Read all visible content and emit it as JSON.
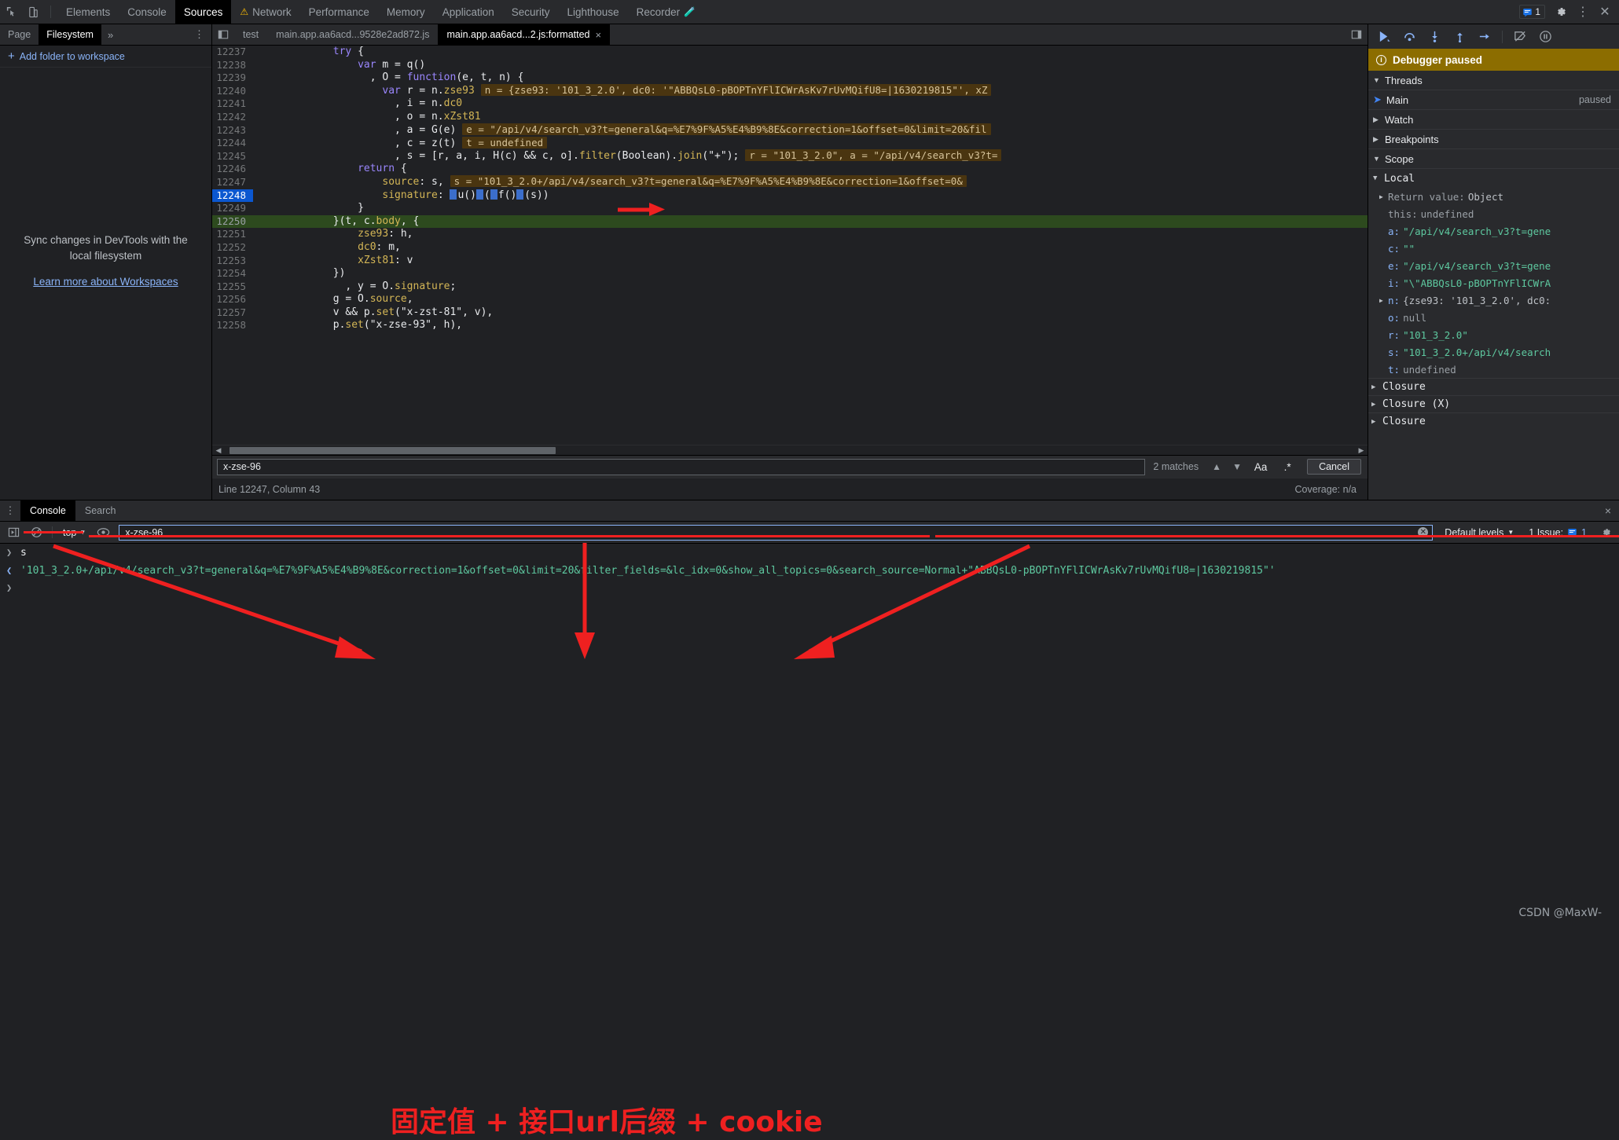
{
  "topbar": {
    "icons": [
      "inspect-element-icon",
      "device-toolbar-icon"
    ],
    "tabs": [
      {
        "label": "Elements",
        "active": false,
        "warn": false
      },
      {
        "label": "Console",
        "active": false,
        "warn": false
      },
      {
        "label": "Sources",
        "active": true,
        "warn": false
      },
      {
        "label": "Network",
        "active": false,
        "warn": true
      },
      {
        "label": "Performance",
        "active": false,
        "warn": false
      },
      {
        "label": "Memory",
        "active": false,
        "warn": false
      },
      {
        "label": "Application",
        "active": false,
        "warn": false
      },
      {
        "label": "Security",
        "active": false,
        "warn": false
      },
      {
        "label": "Lighthouse",
        "active": false,
        "warn": false
      },
      {
        "label": "Recorder",
        "active": false,
        "warn": false,
        "flask": true
      }
    ],
    "message_count": "1",
    "settings_label": "gear-icon",
    "more_label": "more-options-icon",
    "close_label": "close-devtools-icon"
  },
  "navigator": {
    "tabs": [
      {
        "label": "Page",
        "active": false
      },
      {
        "label": "Filesystem",
        "active": true
      }
    ],
    "more": "»",
    "menu": "⋮",
    "add_folder_label": "Add folder to workspace",
    "empty_text": "Sync changes in DevTools with the local filesystem",
    "empty_link": "Learn more about Workspaces"
  },
  "editor": {
    "tabs": [
      {
        "label": "test",
        "active": false,
        "closable": false
      },
      {
        "label": "main.app.aa6acd...9528e2ad872.js",
        "active": false,
        "closable": false
      },
      {
        "label": "main.app.aa6acd...2.js:formatted",
        "active": true,
        "closable": true
      }
    ],
    "close_glyph": "×",
    "lines": [
      {
        "n": "12237",
        "indent": 13,
        "state": "normal",
        "tokens": [
          {
            "t": "try ",
            "c": "k"
          },
          {
            "t": "{",
            "c": "p"
          }
        ]
      },
      {
        "n": "12238",
        "indent": 17,
        "state": "normal",
        "tokens": [
          {
            "t": "var ",
            "c": "k"
          },
          {
            "t": "m = q()",
            "c": "p"
          }
        ]
      },
      {
        "n": "12239",
        "indent": 19,
        "state": "normal",
        "tokens": [
          {
            "t": ", O = ",
            "c": "p"
          },
          {
            "t": "function",
            "c": "k"
          },
          {
            "t": "(e, t, n) {",
            "c": "p"
          }
        ]
      },
      {
        "n": "12240",
        "indent": 21,
        "state": "normal",
        "tokens": [
          {
            "t": "var ",
            "c": "k"
          },
          {
            "t": "r = n.",
            "c": "p"
          },
          {
            "t": "zse93",
            "c": "pr"
          }
        ],
        "hint": "n = {zse93: '101_3_2.0', dc0: '\"ABBQsL0-pBOPTnYFlICWrAsKv7rUvMQifU8=|1630219815\"', xZ"
      },
      {
        "n": "12241",
        "indent": 23,
        "state": "normal",
        "tokens": [
          {
            "t": ", i = n.",
            "c": "p"
          },
          {
            "t": "dc0",
            "c": "pr"
          }
        ]
      },
      {
        "n": "12242",
        "indent": 23,
        "state": "normal",
        "tokens": [
          {
            "t": ", o = n.",
            "c": "p"
          },
          {
            "t": "xZst81",
            "c": "pr"
          }
        ]
      },
      {
        "n": "12243",
        "indent": 23,
        "state": "normal",
        "tokens": [
          {
            "t": ", a = G(e)",
            "c": "p"
          }
        ],
        "hint": "e = \"/api/v4/search_v3?t=general&q=%E7%9F%A5%E4%B9%8E&correction=1&offset=0&limit=20&fil"
      },
      {
        "n": "12244",
        "indent": 23,
        "state": "normal",
        "tokens": [
          {
            "t": ", c = z(t)",
            "c": "p"
          }
        ],
        "hint": "t = undefined"
      },
      {
        "n": "12245",
        "indent": 23,
        "state": "normal",
        "tokens": [
          {
            "t": ", s = [r, a, i, H(c) && c, o].",
            "c": "p"
          },
          {
            "t": "filter",
            "c": "fn"
          },
          {
            "t": "(Boolean).",
            "c": "p"
          },
          {
            "t": "join",
            "c": "fn"
          },
          {
            "t": "(\"+\");",
            "c": "p"
          }
        ],
        "hint": "r = \"101_3_2.0\", a = \"/api/v4/search_v3?t="
      },
      {
        "n": "12246",
        "indent": 17,
        "state": "normal",
        "tokens": [
          {
            "t": "return ",
            "c": "k"
          },
          {
            "t": "{",
            "c": "p"
          }
        ]
      },
      {
        "n": "12247",
        "indent": 21,
        "state": "normal",
        "tokens": [
          {
            "t": "source",
            "c": "pr"
          },
          {
            "t": ": s,",
            "c": "p"
          }
        ],
        "hint": "s = \"101_3_2.0+/api/v4/search_v3?t=general&q=%E7%9F%A5%E4%B9%8E&correction=1&offset=0&"
      },
      {
        "n": "12248",
        "indent": 21,
        "state": "selected",
        "tokens": [
          {
            "t": "signature",
            "c": "pr"
          },
          {
            "t": ": ",
            "c": "p"
          },
          {
            "t": "▶",
            "c": "chip"
          },
          {
            "t": "u()",
            "c": "p"
          },
          {
            "t": "▶",
            "c": "chip"
          },
          {
            "t": "(",
            "c": "p"
          },
          {
            "t": "▶",
            "c": "chip"
          },
          {
            "t": "f()",
            "c": "p"
          },
          {
            "t": "▶",
            "c": "chip"
          },
          {
            "t": "(s))",
            "c": "p"
          }
        ]
      },
      {
        "n": "12249",
        "indent": 17,
        "state": "normal",
        "tokens": [
          {
            "t": "}",
            "c": "p"
          }
        ]
      },
      {
        "n": "12250",
        "indent": 13,
        "state": "exec",
        "tokens": [
          {
            "t": "}(t, c.",
            "c": "p"
          },
          {
            "t": "body",
            "c": "pr"
          },
          {
            "t": ", {",
            "c": "p"
          }
        ]
      },
      {
        "n": "12251",
        "indent": 17,
        "state": "normal",
        "tokens": [
          {
            "t": "zse93",
            "c": "pr"
          },
          {
            "t": ": h,",
            "c": "p"
          }
        ]
      },
      {
        "n": "12252",
        "indent": 17,
        "state": "normal",
        "tokens": [
          {
            "t": "dc0",
            "c": "pr"
          },
          {
            "t": ": m,",
            "c": "p"
          }
        ]
      },
      {
        "n": "12253",
        "indent": 17,
        "state": "normal",
        "tokens": [
          {
            "t": "xZst81",
            "c": "pr"
          },
          {
            "t": ": v",
            "c": "p"
          }
        ]
      },
      {
        "n": "12254",
        "indent": 13,
        "state": "normal",
        "tokens": [
          {
            "t": "})",
            "c": "p"
          }
        ]
      },
      {
        "n": "12255",
        "indent": 15,
        "state": "normal",
        "tokens": [
          {
            "t": ", y = O.",
            "c": "p"
          },
          {
            "t": "signature",
            "c": "pr"
          },
          {
            "t": ";",
            "c": "p"
          }
        ]
      },
      {
        "n": "12256",
        "indent": 13,
        "state": "normal",
        "tokens": [
          {
            "t": "g = O.",
            "c": "p"
          },
          {
            "t": "source",
            "c": "pr"
          },
          {
            "t": ",",
            "c": "p"
          }
        ]
      },
      {
        "n": "12257",
        "indent": 13,
        "state": "normal",
        "tokens": [
          {
            "t": "v && p.",
            "c": "p"
          },
          {
            "t": "set",
            "c": "fn"
          },
          {
            "t": "(\"x-zst-81\", v),",
            "c": "p"
          }
        ]
      },
      {
        "n": "12258",
        "indent": 13,
        "state": "normal",
        "tokens": [
          {
            "t": "p.",
            "c": "p"
          },
          {
            "t": "set",
            "c": "fn"
          },
          {
            "t": "(\"x-zse-93\", h),",
            "c": "p"
          }
        ]
      }
    ],
    "find": {
      "value": "x-zse-96",
      "matches": "2 matches",
      "prev": "prev-match-icon",
      "next": "next-match-icon",
      "match_case": "Aa",
      "regex": ".*",
      "cancel": "Cancel"
    },
    "status_left": "Line 12247, Column 43",
    "status_right": "Coverage: n/a"
  },
  "debugger": {
    "toolbar": [
      "resume-icon",
      "step-over-icon",
      "step-into-icon",
      "step-out-icon",
      "step-icon",
      "deactivate-breakpoints-icon",
      "pause-on-exceptions-icon"
    ],
    "paused_label": "Debugger paused",
    "sections": {
      "threads": "Threads",
      "watch": "Watch",
      "breakpoints": "Breakpoints",
      "scope": "Scope"
    },
    "thread": {
      "name": "Main",
      "status": "paused"
    },
    "scope_local": "Local",
    "variables": [
      {
        "name": "Return value",
        "value": "Object",
        "expandable": true,
        "kind": "obj",
        "hl": false
      },
      {
        "name": "this",
        "value": "undefined",
        "expandable": false,
        "kind": "plain",
        "hl": false
      },
      {
        "name": "a",
        "value": "\"/api/v4/search_v3?t=gene",
        "expandable": false,
        "kind": "str",
        "hl": true
      },
      {
        "name": "c",
        "value": "\"\"",
        "expandable": false,
        "kind": "str",
        "hl": true
      },
      {
        "name": "e",
        "value": "\"/api/v4/search_v3?t=gene",
        "expandable": false,
        "kind": "str",
        "hl": true
      },
      {
        "name": "i",
        "value": "\"\\\"ABBQsL0-pBOPTnYFlICWrA",
        "expandable": false,
        "kind": "str",
        "hl": true
      },
      {
        "name": "n",
        "value": "{zse93: '101_3_2.0', dc0:",
        "expandable": true,
        "kind": "obj",
        "hl": true
      },
      {
        "name": "o",
        "value": "null",
        "expandable": false,
        "kind": "plain",
        "hl": true
      },
      {
        "name": "r",
        "value": "\"101_3_2.0\"",
        "expandable": false,
        "kind": "str",
        "hl": true
      },
      {
        "name": "s",
        "value": "\"101_3_2.0+/api/v4/search",
        "expandable": false,
        "kind": "str",
        "hl": true
      },
      {
        "name": "t",
        "value": "undefined",
        "expandable": false,
        "kind": "plain",
        "hl": true
      }
    ],
    "closures": [
      "Closure",
      "Closure (X)",
      "Closure"
    ]
  },
  "drawer": {
    "tabs": [
      {
        "label": "Console",
        "active": true
      },
      {
        "label": "Search",
        "active": false
      }
    ],
    "menu": "⋮",
    "close": "×",
    "toolbar": {
      "execute_icon": "execute-icon",
      "clear_icon": "clear-console-icon",
      "context": "top",
      "eye_icon": "live-expression-icon",
      "filter_value": "x-zse-96",
      "filter_placeholder": "Filter",
      "levels": "Default levels",
      "issues": "1 Issue:",
      "issues_count": "1",
      "settings_icon": "console-settings-icon"
    },
    "entries": [
      {
        "type": "input",
        "text": "s"
      },
      {
        "type": "output",
        "text": "'101_3_2.0+/api/v4/search_v3?t=general&q=%E7%9F%A5%E4%B9%8E&correction=1&offset=0&limit=20&filter_fields=&lc_idx=0&show_all_topics=0&search_source=Normal+\"ABBQsL0-pBOPTnYFlICWrAsKv7rUvMQifU8=|1630219815\"'"
      }
    ],
    "prompt": ">"
  },
  "annotation": {
    "caption": "固定值 + 接口url后缀 + cookie",
    "color": "#ef2020",
    "watermark": "CSDN @MaxW-"
  }
}
